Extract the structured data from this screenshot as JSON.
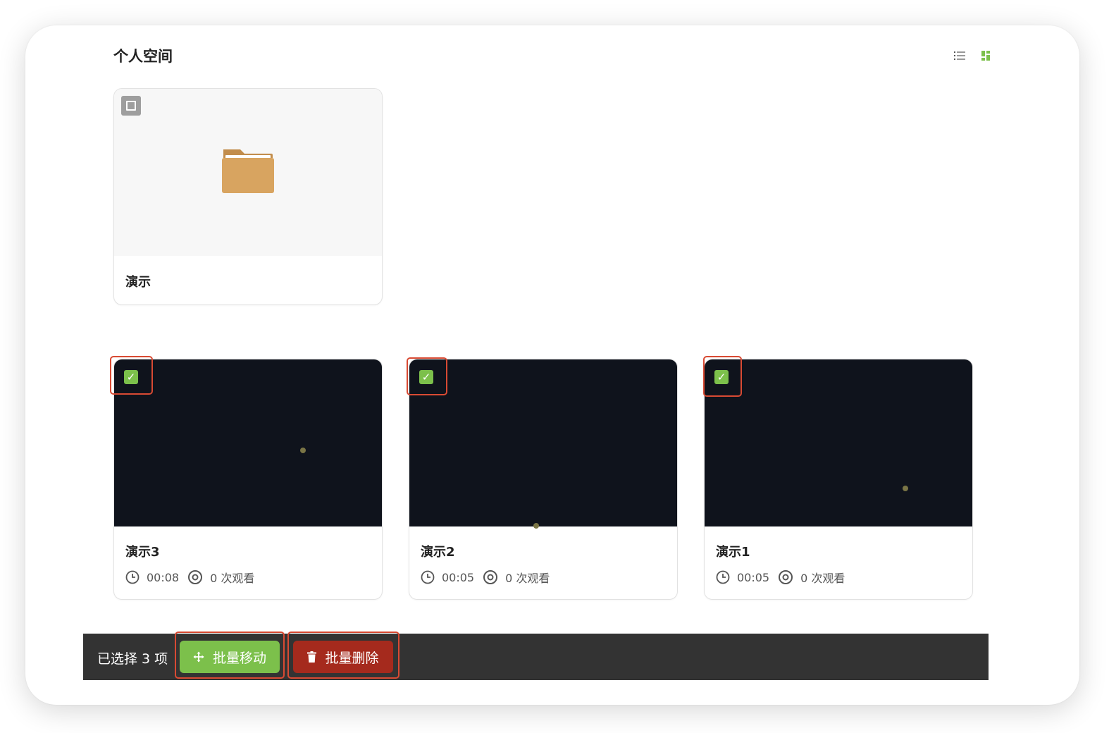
{
  "header": {
    "title": "个人空间",
    "list_view_icon": "list-icon",
    "grid_view_icon": "grid-icon",
    "accent_color": "#7cc04b"
  },
  "folder": {
    "name": "演示",
    "icon": "folder-icon",
    "selected": false,
    "folder_color": "#d8a460"
  },
  "videos": [
    {
      "title": "演示3",
      "duration": "00:08",
      "views": "0 次观看",
      "selected": true
    },
    {
      "title": "演示2",
      "duration": "00:05",
      "views": "0 次观看",
      "selected": true
    },
    {
      "title": "演示1",
      "duration": "00:05",
      "views": "0 次观看",
      "selected": true
    }
  ],
  "action_bar": {
    "selected_text": "已选择 3 项",
    "move_label": "批量移动",
    "delete_label": "批量删除",
    "move_icon": "move-icon",
    "delete_icon": "trash-icon",
    "move_color": "#7cc04b",
    "delete_color": "#a52a1d"
  }
}
